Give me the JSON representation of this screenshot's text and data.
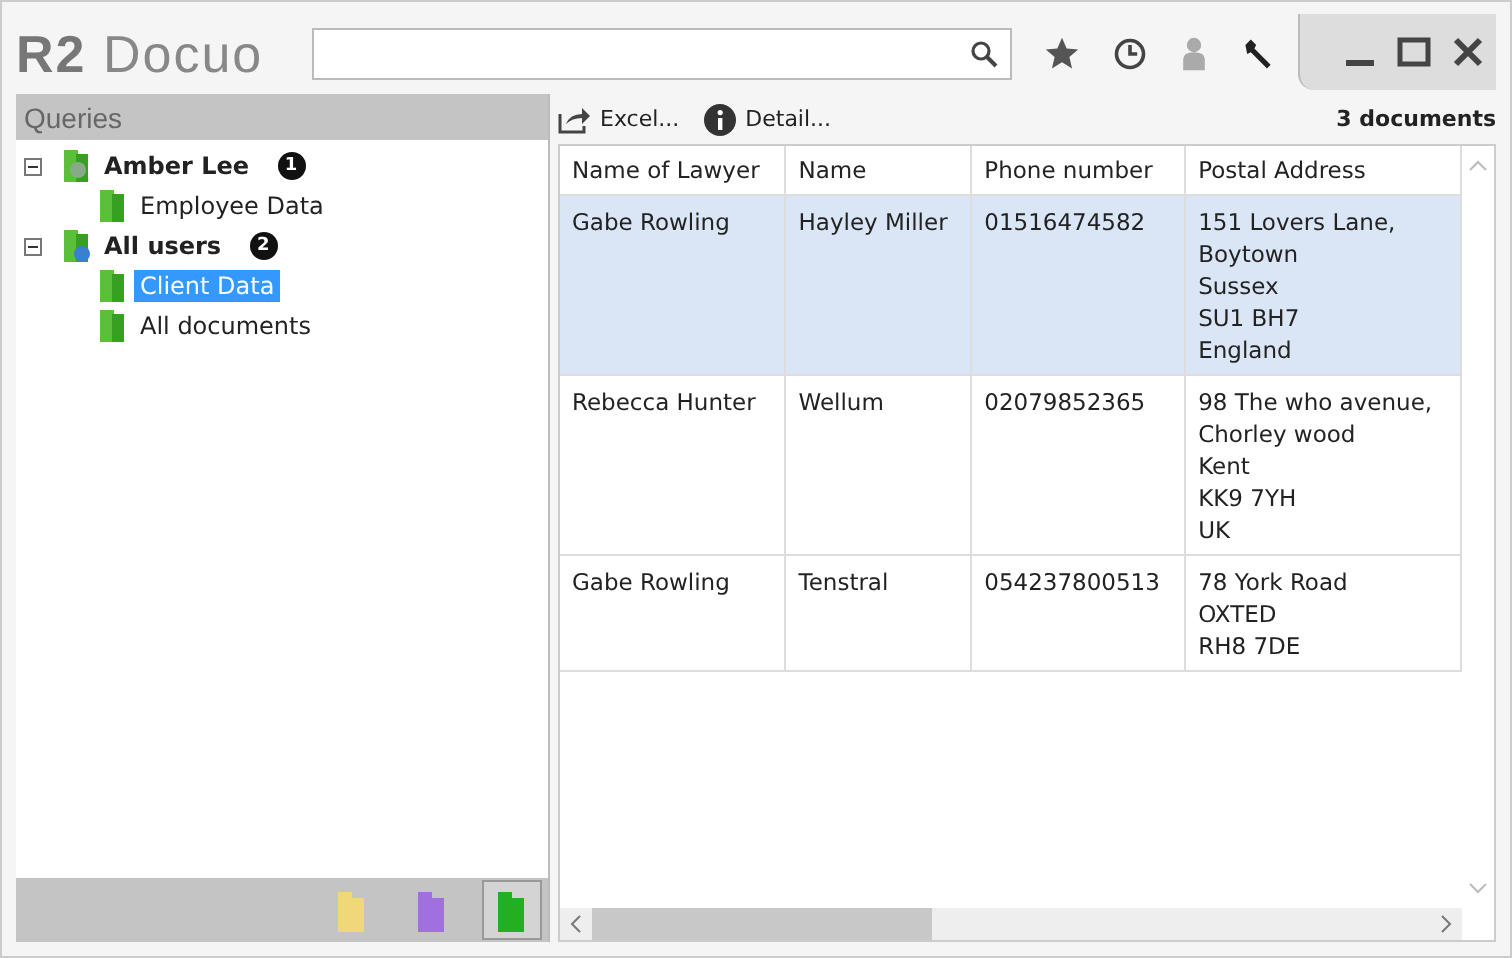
{
  "app": {
    "logo_mark": "R2",
    "logo_name": "Docuo"
  },
  "queries": {
    "title": "Queries",
    "tree": [
      {
        "label": "Amber Lee",
        "kind": "user",
        "expanded": true,
        "badge": "1",
        "selected": false,
        "children": [
          {
            "label": "Employee Data",
            "selected": false
          }
        ]
      },
      {
        "label": "All users",
        "kind": "public",
        "expanded": true,
        "badge": "2",
        "selected": false,
        "children": [
          {
            "label": "Client  Data",
            "selected": true
          },
          {
            "label": "All documents",
            "selected": false
          }
        ]
      }
    ],
    "folder_buttons": [
      {
        "color": "#f0d77a",
        "selected": false
      },
      {
        "color": "#a070e0",
        "selected": false
      },
      {
        "color": "#22b022",
        "selected": true
      }
    ]
  },
  "toolbar": {
    "excel": "Excel...",
    "detail": "Detail...",
    "count": "3 documents"
  },
  "table": {
    "columns": [
      "Name of Lawyer",
      "Name",
      "Phone number",
      "Postal Address"
    ],
    "rows": [
      {
        "selected": true,
        "cells": [
          "Gabe Rowling",
          "Hayley Miller",
          "01516474582"
        ],
        "address": [
          "151 Lovers Lane,",
          "Boytown",
          "Sussex",
          "SU1 BH7",
          "England"
        ]
      },
      {
        "selected": false,
        "cells": [
          "Rebecca Hunter",
          "Wellum",
          "02079852365"
        ],
        "address": [
          "98 The who avenue,",
          "Chorley wood",
          "Kent",
          "KK9 7YH",
          "UK"
        ]
      },
      {
        "selected": false,
        "cells": [
          "Gabe Rowling",
          "Tenstral",
          "054237800513"
        ],
        "address": [
          "78 York Road",
          "OXTED",
          "RH8 7DE"
        ]
      }
    ]
  }
}
